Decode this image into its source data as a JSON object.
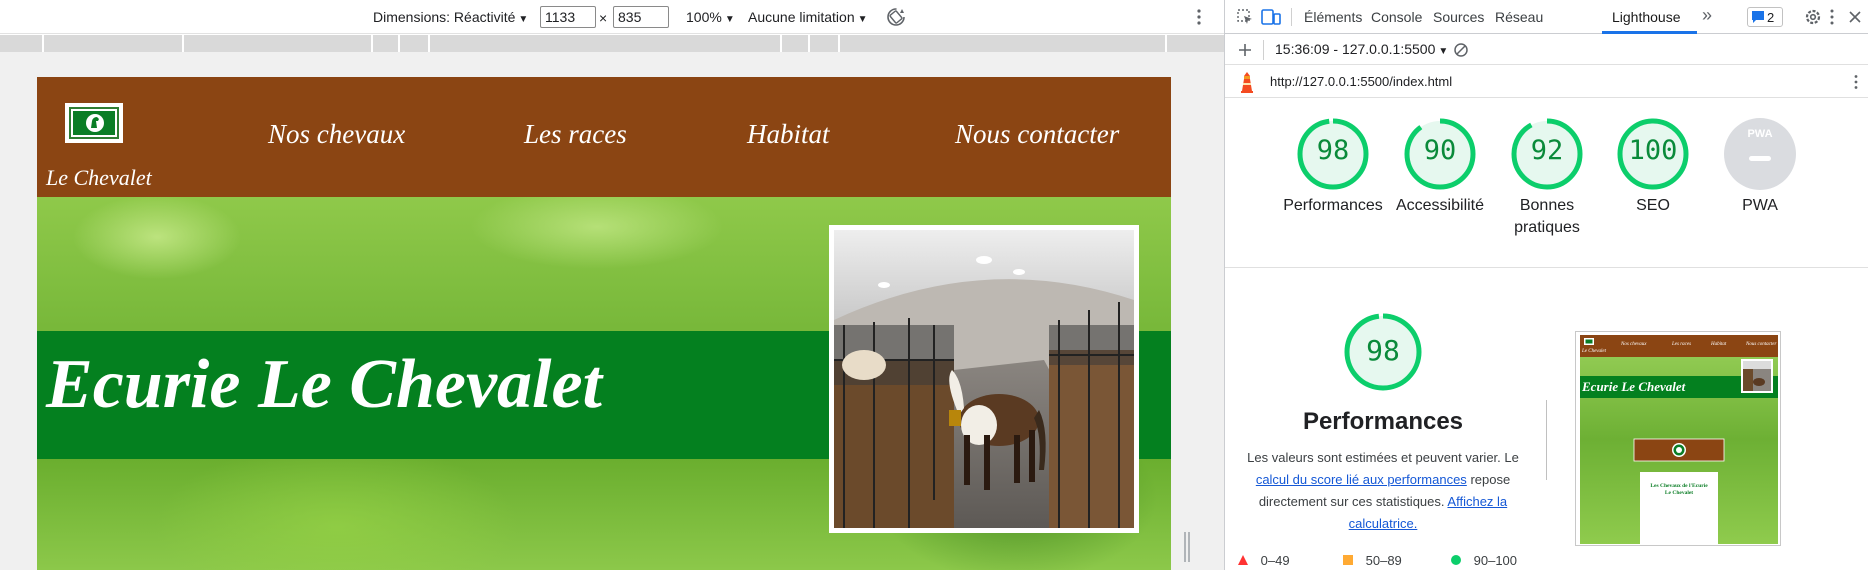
{
  "device_toolbar": {
    "dimensions_label": "Dimensions: Réactivité",
    "width_value": "1133",
    "times": "×",
    "height_value": "835",
    "zoom": "100%",
    "throttling": "Aucune limitation"
  },
  "website": {
    "site_name": "Le Chevalet",
    "nav": [
      "Nos chevaux",
      "Les races",
      "Habitat",
      "Nous contacter"
    ],
    "hero_title": "Ecurie Le Chevalet",
    "colors": {
      "header": "#8b4513",
      "band": "#04801f",
      "text": "#ffffff"
    }
  },
  "devtools": {
    "tabs": [
      "Éléments",
      "Console",
      "Sources",
      "Réseau",
      "Lighthouse"
    ],
    "active_tab": "Lighthouse",
    "issues_count": "2",
    "report_selector": "15:36:09 - 127.0.0.1:5500",
    "report_url": "http://127.0.0.1:5500/index.html",
    "scores": [
      {
        "label": "Performances",
        "value": "98"
      },
      {
        "label": "Accessibilité",
        "value": "90"
      },
      {
        "label": "Bonnes pratiques",
        "value": "92"
      },
      {
        "label": "SEO",
        "value": "100"
      },
      {
        "label": "PWA",
        "value": ""
      }
    ],
    "pwa_badge": "PWA",
    "performance": {
      "score": "98",
      "title": "Performances",
      "desc_1": "Les valeurs sont estimées et peuvent varier. Le",
      "link_1": "calcul du score lié aux performances",
      "desc_2": "repose directement sur ces statistiques.",
      "link_2": "Affichez la calculatrice."
    },
    "legend": [
      {
        "range": "0–49",
        "color": "#ff3333"
      },
      {
        "range": "50–89",
        "color": "#ffaa33"
      },
      {
        "range": "90–100",
        "color": "#0cce6b"
      }
    ],
    "thumbnail": {
      "nav": [
        "Nos chevaux",
        "Les races",
        "Habitat",
        "Nous contacter"
      ],
      "site_name": "Le Chevalet",
      "hero_title": "Ecurie Le Chevalet",
      "card_line1": "Les Chevaux de l'Ecurie",
      "card_line2": "Le Chevalet"
    }
  }
}
